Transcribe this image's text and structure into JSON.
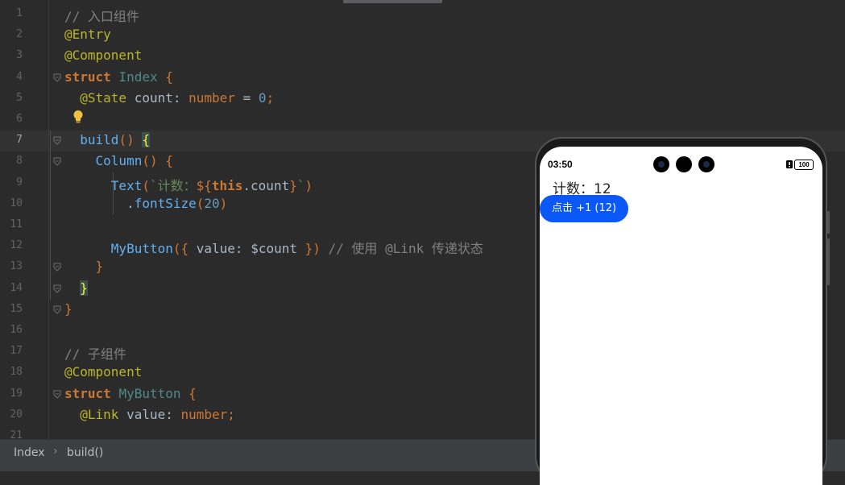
{
  "editor": {
    "lines": [
      {
        "n": "1",
        "segs": [
          [
            "cm",
            "// 入口组件"
          ]
        ]
      },
      {
        "n": "2",
        "segs": [
          [
            "ann",
            "@Entry"
          ]
        ]
      },
      {
        "n": "3",
        "segs": [
          [
            "ann",
            "@Component"
          ]
        ]
      },
      {
        "n": "4",
        "segs": [
          [
            "kwb",
            "struct "
          ],
          [
            "ty",
            "Index "
          ],
          [
            "kw",
            "{"
          ]
        ]
      },
      {
        "n": "5",
        "segs": [
          [
            "",
            "  "
          ],
          [
            "ann",
            "@State "
          ],
          [
            "",
            "count: "
          ],
          [
            "kw",
            "number "
          ],
          [
            "",
            "= "
          ],
          [
            "num",
            "0"
          ],
          [
            "kw",
            ";"
          ]
        ]
      },
      {
        "n": "6",
        "segs": []
      },
      {
        "n": "7",
        "segs": [
          [
            "",
            "  "
          ],
          [
            "fn",
            "build"
          ],
          [
            "kw",
            "() "
          ],
          [
            "brkhl",
            "{"
          ]
        ]
      },
      {
        "n": "8",
        "segs": [
          [
            "",
            "    "
          ],
          [
            "fn",
            "Column"
          ],
          [
            "kw",
            "() {"
          ]
        ]
      },
      {
        "n": "9",
        "segs": [
          [
            "",
            "      "
          ],
          [
            "fn",
            "Text"
          ],
          [
            "kw",
            "("
          ],
          [
            "str",
            "`计数："
          ],
          [
            "tmpl",
            "${"
          ],
          [
            "this",
            "this"
          ],
          [
            "",
            ".count"
          ],
          [
            "tmpl",
            "}"
          ],
          [
            "str",
            "`"
          ],
          [
            "kw",
            ")"
          ]
        ]
      },
      {
        "n": "10",
        "segs": [
          [
            "",
            "        ."
          ],
          [
            "fn",
            "fontSize"
          ],
          [
            "kw",
            "("
          ],
          [
            "num",
            "20"
          ],
          [
            "kw",
            ")"
          ]
        ]
      },
      {
        "n": "11",
        "segs": []
      },
      {
        "n": "12",
        "segs": [
          [
            "",
            "      "
          ],
          [
            "fn",
            "MyButton"
          ],
          [
            "kw",
            "({ "
          ],
          [
            "",
            "value: $count "
          ],
          [
            "kw",
            "}) "
          ],
          [
            "cm",
            "// 使用 @Link 传递状态"
          ]
        ]
      },
      {
        "n": "13",
        "segs": [
          [
            "",
            "    "
          ],
          [
            "kw",
            "}"
          ]
        ]
      },
      {
        "n": "14",
        "segs": [
          [
            "",
            "  "
          ],
          [
            "brkhl",
            "}"
          ]
        ]
      },
      {
        "n": "15",
        "segs": [
          [
            "kw",
            "}"
          ]
        ]
      },
      {
        "n": "16",
        "segs": []
      },
      {
        "n": "17",
        "segs": [
          [
            "cm",
            "// 子组件"
          ]
        ]
      },
      {
        "n": "18",
        "segs": [
          [
            "ann",
            "@Component"
          ]
        ]
      },
      {
        "n": "19",
        "segs": [
          [
            "kwb",
            "struct "
          ],
          [
            "ty",
            "MyButton "
          ],
          [
            "kw",
            "{"
          ]
        ]
      },
      {
        "n": "20",
        "segs": [
          [
            "",
            "  "
          ],
          [
            "ann",
            "@Link "
          ],
          [
            "",
            "value: "
          ],
          [
            "kw",
            "number"
          ],
          [
            "kw",
            ";"
          ]
        ]
      },
      {
        "n": "21",
        "segs": []
      }
    ],
    "current_line": "7",
    "colors": {
      "background": "#2b2b2b",
      "keyword": "#cc7832",
      "annotation": "#bbb529",
      "comment": "#808080",
      "number": "#6897bb",
      "function": "#61afef"
    }
  },
  "breadcrumb": {
    "items": [
      "Index",
      "build()"
    ]
  },
  "preview": {
    "status_time": "03:50",
    "battery": "100",
    "count_text": "计数：12",
    "button_label": "点击 +1 (12)",
    "button_color": "#0a59f7"
  }
}
